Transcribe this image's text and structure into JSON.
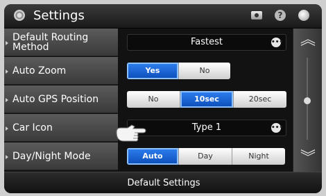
{
  "header": {
    "title": "Settings",
    "icons": [
      "settings-icon",
      "camera-icon",
      "help-icon",
      "globe-icon"
    ]
  },
  "settings": [
    {
      "label": "Default Routing Method",
      "type": "dropdown",
      "value": "Fastest"
    },
    {
      "label": "Auto Zoom",
      "type": "segmented",
      "options": [
        "Yes",
        "No"
      ],
      "selected": "Yes"
    },
    {
      "label": "Auto GPS Position",
      "type": "segmented",
      "options": [
        "No",
        "10sec",
        "20sec"
      ],
      "selected": "10sec"
    },
    {
      "label": "Car Icon",
      "type": "dropdown",
      "value": "Type 1"
    },
    {
      "label": "Day/Night Mode",
      "type": "segmented",
      "options": [
        "Auto",
        "Day",
        "Night"
      ],
      "selected": "Auto"
    }
  ],
  "bottom": {
    "button_label": "Default Settings"
  },
  "colors": {
    "accent": "#1f63d6",
    "background": "#121212"
  }
}
